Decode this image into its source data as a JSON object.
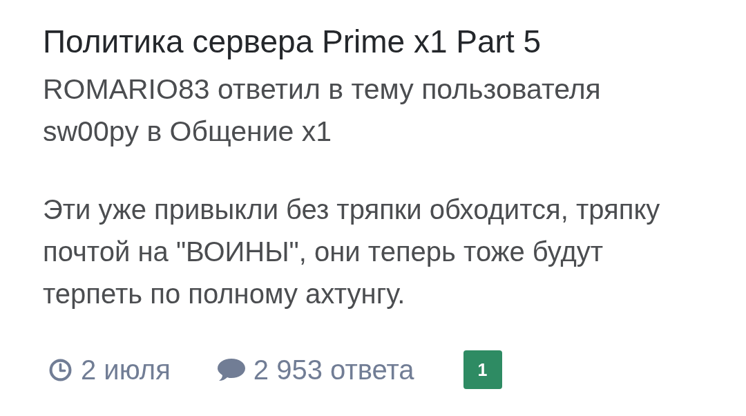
{
  "topic": {
    "title": "Политика сервера Prime x1 Part 5",
    "subtitle": "ROMARIO83 ответил в тему пользователя sw00py в Общение x1"
  },
  "post": {
    "text": "Эти уже привыкли без тряпки обходится, тряпку почтой на \"ВОИНЫ\", они теперь тоже будут терпеть по полному ахтунгу."
  },
  "meta": {
    "date": "2 июля",
    "replies": "2 953 ответа",
    "badge": "1"
  }
}
